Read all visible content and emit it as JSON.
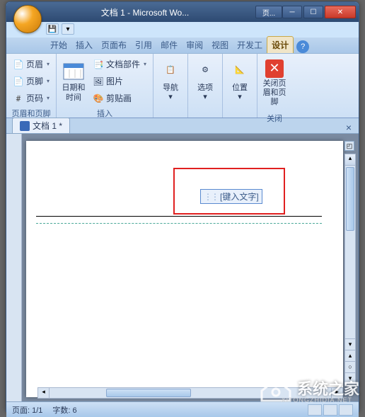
{
  "window": {
    "title": "文档 1 - Microsoft Wo...",
    "page_label": "页..."
  },
  "tabs": {
    "items": [
      "开始",
      "插入",
      "页面布",
      "引用",
      "邮件",
      "审阅",
      "视图",
      "开发工",
      "设计"
    ],
    "active_index": 8
  },
  "ribbon": {
    "group_header_footer": {
      "label": "页眉和页脚",
      "header": "页眉",
      "footer": "页脚",
      "page_number": "页码"
    },
    "group_insert": {
      "label": "插入",
      "datetime": "日期和时间",
      "parts": "文档部件",
      "picture": "图片",
      "clipart": "剪贴画"
    },
    "group_nav": {
      "label": "",
      "nav": "导航"
    },
    "group_options": {
      "label": "",
      "options": "选项"
    },
    "group_position": {
      "label": "",
      "position": "位置"
    },
    "group_close": {
      "label": "关闭",
      "close": "关闭页眉和页脚"
    }
  },
  "doc_tab": {
    "name": "文档 1 *"
  },
  "header_placeholder": "[键入文字]",
  "status": {
    "page": "页面: 1/1",
    "words": "字数: 6"
  },
  "watermark": {
    "text": "系统之家",
    "sub": "XITONGZHIDIA.NET"
  }
}
